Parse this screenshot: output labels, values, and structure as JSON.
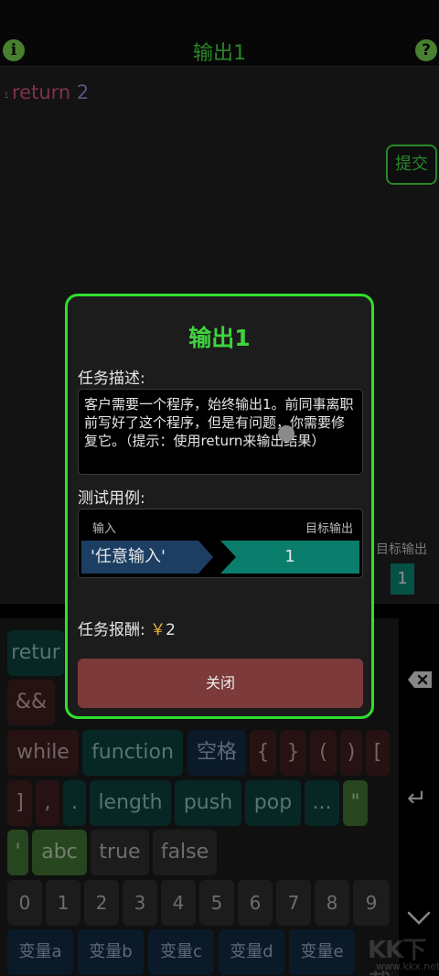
{
  "header": {
    "title": "输出1",
    "info_icon": "i",
    "help_icon": "?"
  },
  "editor": {
    "line_number": "1",
    "code_keyword": "return",
    "code_value": "2",
    "submit_label": "提交"
  },
  "output_panel": {
    "label": "目标输出",
    "value": "1"
  },
  "keyboard": {
    "row1": [
      "retur",
      "&&"
    ],
    "row2": [
      "while",
      "function",
      "空格",
      "{",
      "}",
      "(",
      ")",
      "["
    ],
    "row3": [
      "]",
      ",",
      ".",
      "length",
      "push",
      "pop",
      "...",
      "\""
    ],
    "row4": [
      "'",
      "abc",
      "true",
      "false"
    ],
    "row5": [
      "0",
      "1",
      "2",
      "3",
      "4",
      "5",
      "6",
      "7",
      "8",
      "9"
    ],
    "row6": [
      "变量a",
      "变量b",
      "变量c",
      "变量d",
      "变量e"
    ]
  },
  "modal": {
    "title": "输出1",
    "task_label": "任务描述:",
    "task_text": "客户需要一个程序，始终输出1。前同事离职前写好了这个程序，但是有问题，你需要修复它。（提示：使用return来输出结果）",
    "test_label": "测试用例:",
    "input_header": "输入",
    "output_header": "目标输出",
    "test_input": "'任意输入'",
    "test_output": "1",
    "reward_label": "任务报酬:",
    "reward_currency": "￥",
    "reward_value": "2",
    "close_label": "关闭"
  },
  "watermark": {
    "brand": "KK下载",
    "url": "www.kkx.net"
  },
  "colors": {
    "accent_green": "#3ecf3e",
    "teal": "#0b7d6c",
    "blue": "#1c3e63",
    "close_red": "#7d3a3a",
    "reward_gold": "#e5b132"
  }
}
